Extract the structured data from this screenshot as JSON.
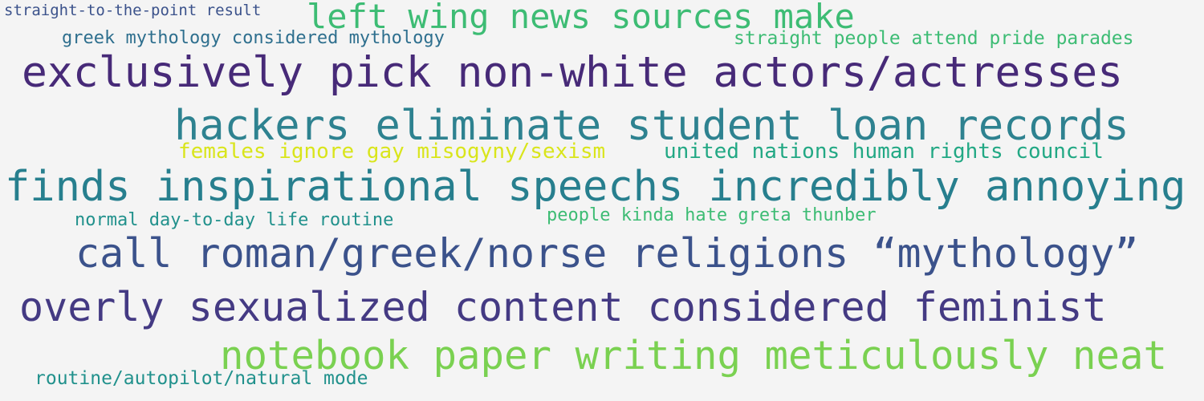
{
  "colors": {
    "background": "#f4f4f4",
    "dark_purple": "#472a78",
    "indigo": "#443a83",
    "blue": "#3b528b",
    "dark_teal": "#2e6f8e",
    "teal": "#21918c",
    "teal_green": "#22a884",
    "green": "#3dbc74",
    "light_green": "#7ad151",
    "yellow": "#d9e51b"
  },
  "phrases": [
    {
      "text": "straight-to-the-point result",
      "color": "#3b528b"
    },
    {
      "text": "left wing news sources make",
      "color": "#3dbc74"
    },
    {
      "text": "greek mythology considered mythology",
      "color": "#2e6f8e"
    },
    {
      "text": "straight people attend pride parades",
      "color": "#3dbc74"
    },
    {
      "text": "exclusively pick non-white actors/actresses",
      "color": "#472a78"
    },
    {
      "text": "hackers eliminate student loan records",
      "color": "#2e8290"
    },
    {
      "text": "females ignore gay misogyny/sexism",
      "color": "#d9e51b"
    },
    {
      "text": "united nations human rights council",
      "color": "#22a884"
    },
    {
      "text": "finds inspirational speechs incredibly annoying",
      "color": "#277f8e"
    },
    {
      "text": "normal day-to-day life routine",
      "color": "#21918c"
    },
    {
      "text": "people kinda hate greta thunber",
      "color": "#3dbc74"
    },
    {
      "text": "call roman/greek/norse religions “mythology”",
      "color": "#3b528b"
    },
    {
      "text": "overly sexualized content considered feminist",
      "color": "#443a83"
    },
    {
      "text": "notebook paper writing meticulously neat",
      "color": "#7ad151"
    },
    {
      "text": "routine/autopilot/natural mode",
      "color": "#21918c"
    }
  ]
}
